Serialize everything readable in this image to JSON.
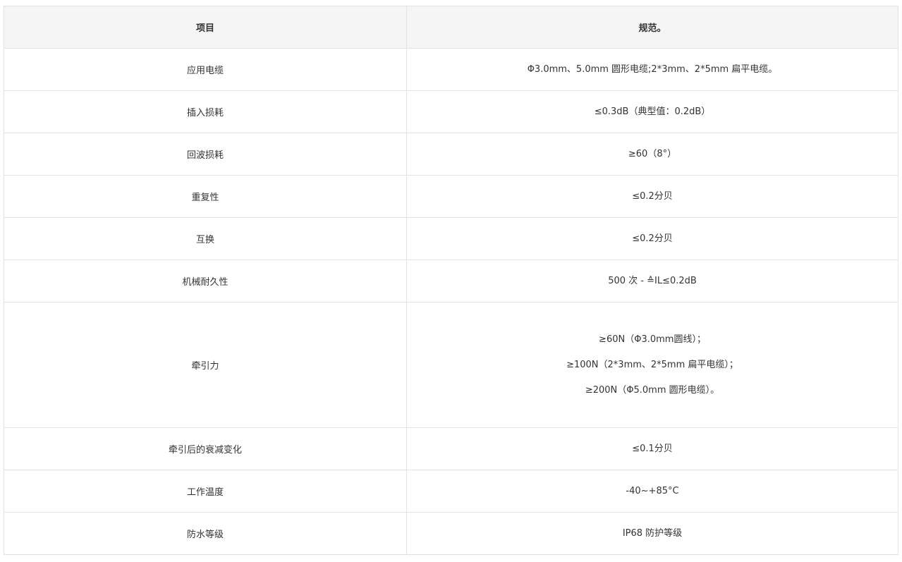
{
  "table": {
    "headers": {
      "item": "项目",
      "spec": "规范。"
    },
    "rows": [
      {
        "item": "应用电缆",
        "spec": [
          "Φ3.0mm、5.0mm 圆形电缆;2*3mm、2*5mm 扁平电缆。"
        ]
      },
      {
        "item": "插入损耗",
        "spec": [
          "≤0.3dB（典型值：0.2dB）"
        ]
      },
      {
        "item": "回波损耗",
        "spec": [
          "≥60（8°）"
        ]
      },
      {
        "item": "重复性",
        "spec": [
          "≤0.2分贝"
        ]
      },
      {
        "item": "互换",
        "spec": [
          "≤0.2分贝"
        ]
      },
      {
        "item": "机械耐久性",
        "spec": [
          "500 次 - ≙IL≤0.2dB"
        ]
      },
      {
        "item": "牵引力",
        "spec": [
          "≥60N（Φ3.0mm圆线）；",
          "≥100N（2*3mm、2*5mm 扁平电缆）；",
          "≥200N（Φ5.0mm 圆形电缆）。"
        ]
      },
      {
        "item": "牵引后的衰减变化",
        "spec": [
          "≤0.1分贝"
        ]
      },
      {
        "item": "工作温度",
        "spec": [
          "-40~+85°C"
        ]
      },
      {
        "item": "防水等级",
        "spec": [
          "IP68 防护等级"
        ]
      }
    ]
  }
}
